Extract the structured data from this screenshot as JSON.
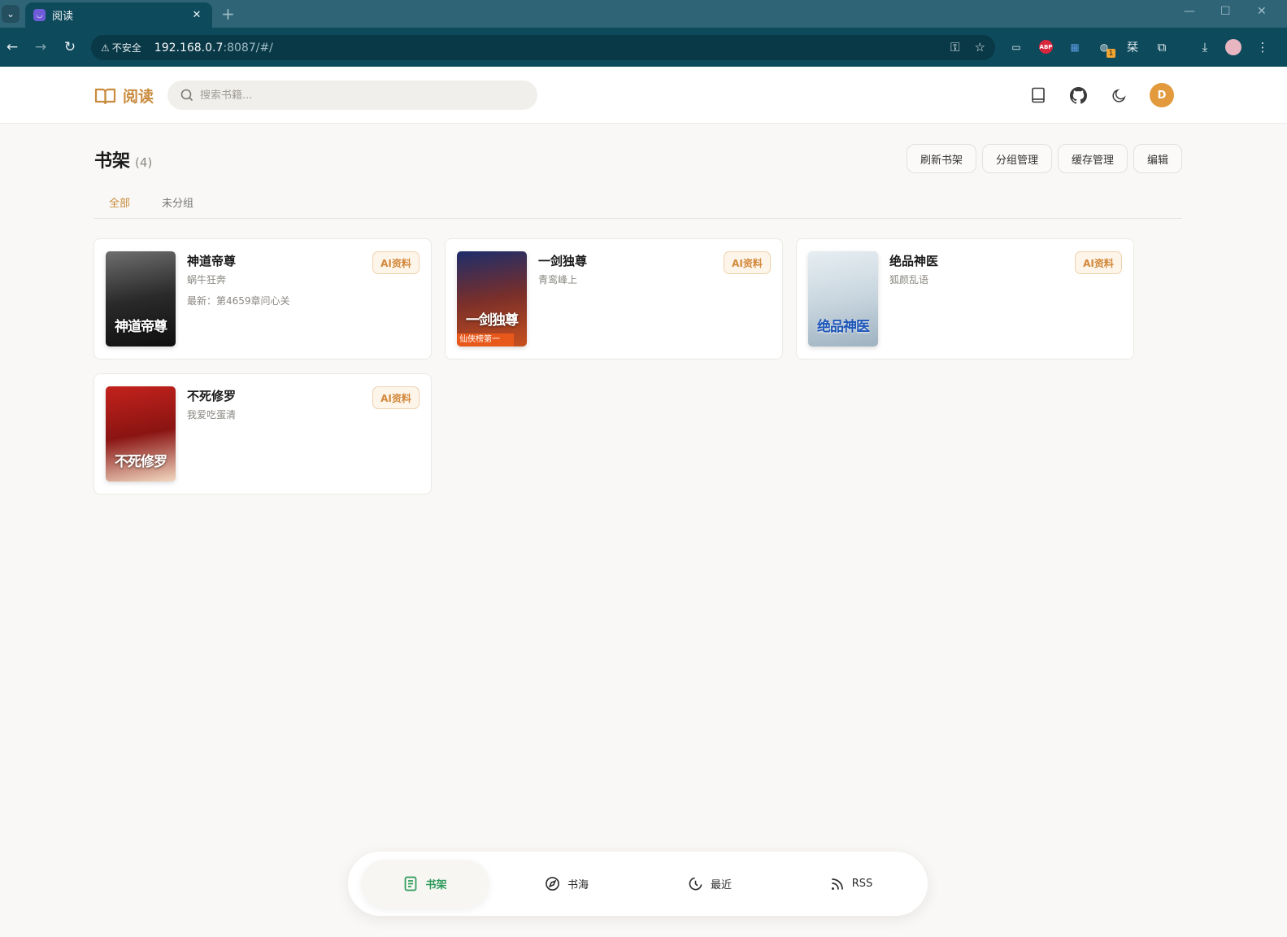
{
  "browser": {
    "tab_title": "阅读",
    "tab_close": "✕",
    "new_tab": "+",
    "insecure_label": "不安全",
    "url_host": "192.168.0.7",
    "url_path": ":8087/#/",
    "ext_badge": "1",
    "ext_abp": "ABP",
    "ext_text": "栞"
  },
  "app": {
    "logo_text": "阅读",
    "search_placeholder": "搜索书籍...",
    "user_initial": "D"
  },
  "shelf": {
    "title": "书架",
    "count": "(4)",
    "actions": {
      "refresh": "刷新书架",
      "groups": "分组管理",
      "cache": "缓存管理",
      "edit": "编辑"
    },
    "tabs": [
      {
        "label": "全部",
        "active": true
      },
      {
        "label": "未分组",
        "active": false
      }
    ],
    "ai_label": "AI资料",
    "books": [
      {
        "title": "神道帝尊",
        "author": "蜗牛狂奔",
        "latest": "最新：第4659章问心关",
        "cover_text": "神道帝尊",
        "cover_colors": [
          "#6e6e6e",
          "#2a2a2a",
          "#0f0f0f"
        ]
      },
      {
        "title": "一剑独尊",
        "author": "青鸾峰上",
        "latest": "",
        "cover_text": "一剑独尊",
        "cover_tag": "仙侠榜第一",
        "cover_colors": [
          "#1d2d6b",
          "#7a2f2a",
          "#c8501e"
        ]
      },
      {
        "title": "绝品神医",
        "author": "狐颜乱语",
        "latest": "",
        "cover_text": "绝品神医",
        "cover_colors": [
          "#e6eef2",
          "#c9d6df",
          "#9eb2c0"
        ]
      },
      {
        "title": "不死修罗",
        "author": "我爱吃蛋清",
        "latest": "",
        "cover_text": "不死修罗",
        "cover_colors": [
          "#c4221c",
          "#8a1412",
          "#f2d9c2"
        ]
      }
    ]
  },
  "bottom_nav": [
    {
      "label": "书架",
      "icon": "bookshelf-icon",
      "active": true
    },
    {
      "label": "书海",
      "icon": "compass-icon",
      "active": false
    },
    {
      "label": "最近",
      "icon": "clock-icon",
      "active": false
    },
    {
      "label": "RSS",
      "icon": "rss-icon",
      "active": false
    }
  ],
  "colors": {
    "accent": "#c98b3d",
    "nav_active": "#2e9a5a",
    "browser_frame": "#0d4a5c",
    "avatar": "#e29a3d"
  }
}
